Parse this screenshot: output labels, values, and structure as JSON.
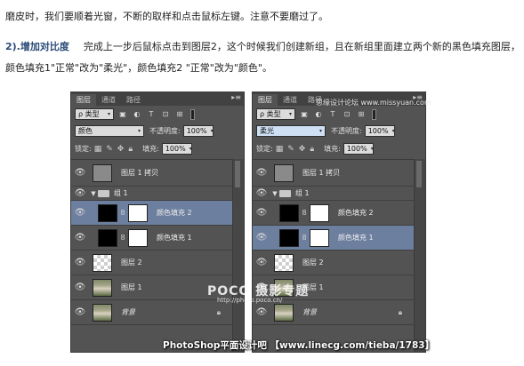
{
  "article": {
    "line1": "磨皮时，我们要顺着光窗，不断的取样和点击鼠标左键。注意不要磨过了。",
    "step_label": "2).增加对比度",
    "line2": "完成上一步后鼠标点击到图层2，这个时候我们创建新组，且在新组里面建立两个新的黑色填充图层，",
    "line3": "颜色填充1\"正常\"改为\"柔光\"，颜色填充2 \"正常\"改为\"颜色\"。"
  },
  "left_panel": {
    "tabs": [
      "图层",
      "通道",
      "路径"
    ],
    "kind_label": "ρ 类型",
    "blend_mode": "颜色",
    "opacity_label": "不透明度:",
    "opacity_value": "100%",
    "lock_label": "锁定:",
    "fill_label": "填充:",
    "fill_value": "100%",
    "layers": {
      "copy": "图层 1 拷贝",
      "group": "组 1",
      "fill2": "颜色填充 2",
      "fill1": "颜色填充 1",
      "layer2": "图层 2",
      "layer1": "图层 1",
      "background": "背景"
    }
  },
  "right_panel": {
    "tabs": [
      "图层",
      "通道",
      "路径"
    ],
    "kind_label": "ρ 类型",
    "blend_mode": "柔光",
    "opacity_label": "不透明度:",
    "opacity_value": "100%",
    "lock_label": "锁定:",
    "fill_label": "填充:",
    "fill_value": "100%",
    "layers": {
      "copy": "图层 1 拷贝",
      "group": "组 1",
      "fill2": "颜色填充 2",
      "fill1": "颜色填充 1",
      "layer2": "图层 2",
      "layer1": "图层 1",
      "background": "背景"
    }
  },
  "watermarks": {
    "top": "思缘设计论坛 www.missyuan.com",
    "poco": "POCO 摄影专题",
    "poco_url": "http://photo.poco.cn/",
    "bottom": "PhotoShop平面设计吧 【www.linecg.com/tieba/1783】"
  },
  "colors": {
    "panel_bg": "#535353",
    "selected_row": "#6d7f9f",
    "step_label": "#2b4a78"
  }
}
